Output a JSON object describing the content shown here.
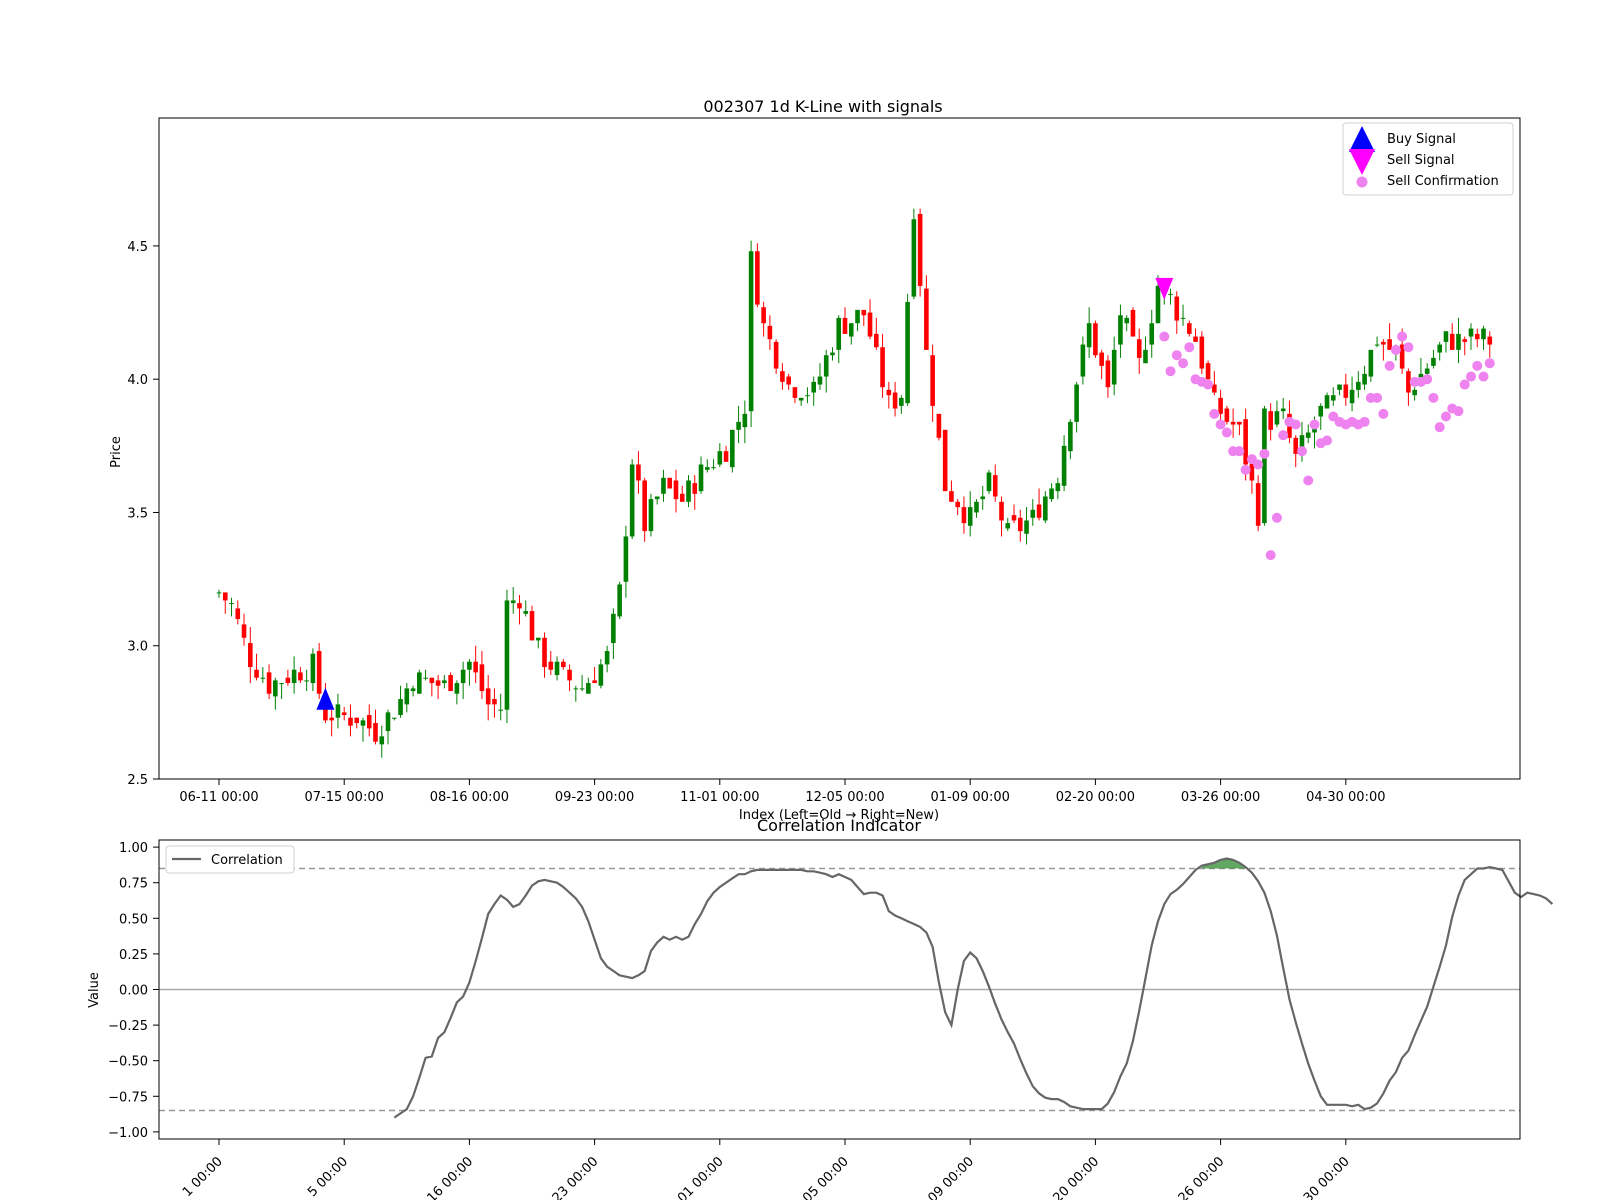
{
  "price_chart": {
    "title": "002307 1d K-Line with signals",
    "ylabel": "Price",
    "xlabel": "Index (Left=Old → Right=New)",
    "ylim": [
      2.5,
      4.98
    ],
    "yticks": [
      "2.5",
      "3.0",
      "3.5",
      "4.0",
      "4.5"
    ],
    "ytick_values": [
      2.5,
      3.0,
      3.5,
      4.0,
      4.5
    ],
    "xticks": [
      "06-11 00:00",
      "07-15 00:00",
      "08-16 00:00",
      "09-23 00:00",
      "11-01 00:00",
      "12-05 00:00",
      "01-09 00:00",
      "02-20 00:00",
      "03-26 00:00",
      "04-30 00:00"
    ],
    "legend": {
      "position": "top-right",
      "items": [
        {
          "label": "Buy Signal",
          "marker": "triangle-up",
          "color": "#0000ff"
        },
        {
          "label": "Sell Signal",
          "marker": "triangle-down",
          "color": "#ff00ff"
        },
        {
          "label": "Sell Confirmation",
          "marker": "circle",
          "color": "#ee82ee"
        }
      ]
    },
    "colors": {
      "up": "#008000",
      "down": "#ff0000"
    }
  },
  "correlation_chart": {
    "title": "Correlation Indicator",
    "ylabel": "Value",
    "ylim": [
      -1.05,
      1.05
    ],
    "yticks": [
      "1.00",
      "0.75",
      "0.50",
      "0.25",
      "0.00",
      "−0.25",
      "−0.50",
      "−0.75",
      "−1.00"
    ],
    "ytick_values": [
      1.0,
      0.75,
      0.5,
      0.25,
      0.0,
      -0.25,
      -0.5,
      -0.75,
      -1.0
    ],
    "xticks": [
      "1 00:00",
      "5 00:00",
      "16 00:00",
      "23 00:00",
      "01 00:00",
      "05 00:00",
      "09 00:00",
      "20 00:00",
      "26 00:00",
      "30 00:00"
    ],
    "legend": {
      "position": "top-left",
      "items": [
        {
          "label": "Correlation",
          "color": "#666666"
        }
      ]
    },
    "thresholds": [
      0.85,
      -0.85
    ],
    "zero_line": 0.0
  },
  "chart_data": {
    "type": "candlestick",
    "x_tick_indices": [
      0,
      20,
      40,
      60,
      80,
      100,
      120,
      140,
      160,
      180
    ],
    "candles": [],
    "buy_signals": [
      {
        "index": 17,
        "price": 2.79
      }
    ],
    "sell_signals": [
      {
        "index": 151,
        "price": 4.35
      }
    ],
    "sell_confirmations": [
      {
        "index": 151,
        "price": 4.16
      },
      {
        "index": 152,
        "price": 4.03
      },
      {
        "index": 153,
        "price": 4.09
      },
      {
        "index": 154,
        "price": 4.06
      },
      {
        "index": 155,
        "price": 4.12
      },
      {
        "index": 156,
        "price": 4.0
      },
      {
        "index": 157,
        "price": 3.99
      },
      {
        "index": 158,
        "price": 3.98
      },
      {
        "index": 159,
        "price": 3.87
      },
      {
        "index": 160,
        "price": 3.83
      },
      {
        "index": 161,
        "price": 3.8
      },
      {
        "index": 162,
        "price": 3.73
      },
      {
        "index": 163,
        "price": 3.73
      },
      {
        "index": 164,
        "price": 3.66
      },
      {
        "index": 165,
        "price": 3.7
      },
      {
        "index": 166,
        "price": 3.68
      },
      {
        "index": 167,
        "price": 3.72
      },
      {
        "index": 168,
        "price": 3.34
      },
      {
        "index": 169,
        "price": 3.48
      },
      {
        "index": 170,
        "price": 3.79
      },
      {
        "index": 171,
        "price": 3.84
      },
      {
        "index": 172,
        "price": 3.83
      },
      {
        "index": 173,
        "price": 3.73
      },
      {
        "index": 174,
        "price": 3.62
      },
      {
        "index": 175,
        "price": 3.83
      },
      {
        "index": 176,
        "price": 3.76
      },
      {
        "index": 177,
        "price": 3.77
      },
      {
        "index": 178,
        "price": 3.86
      },
      {
        "index": 179,
        "price": 3.84
      },
      {
        "index": 180,
        "price": 3.83
      },
      {
        "index": 181,
        "price": 3.84
      },
      {
        "index": 182,
        "price": 3.83
      },
      {
        "index": 183,
        "price": 3.84
      },
      {
        "index": 184,
        "price": 3.93
      },
      {
        "index": 185,
        "price": 3.93
      },
      {
        "index": 186,
        "price": 3.87
      },
      {
        "index": 187,
        "price": 4.05
      },
      {
        "index": 188,
        "price": 4.11
      },
      {
        "index": 189,
        "price": 4.16
      },
      {
        "index": 190,
        "price": 4.12
      },
      {
        "index": 191,
        "price": 3.99
      },
      {
        "index": 192,
        "price": 3.99
      },
      {
        "index": 193,
        "price": 4.0
      },
      {
        "index": 194,
        "price": 3.93
      },
      {
        "index": 195,
        "price": 3.82
      },
      {
        "index": 196,
        "price": 3.86
      },
      {
        "index": 197,
        "price": 3.89
      },
      {
        "index": 198,
        "price": 3.88
      },
      {
        "index": 199,
        "price": 3.98
      },
      {
        "index": 200,
        "price": 4.01
      },
      {
        "index": 201,
        "price": 4.05
      },
      {
        "index": 202,
        "price": 4.01
      },
      {
        "index": 203,
        "price": 4.06
      }
    ],
    "correlation": {
      "name": "Correlation",
      "start_index": 28,
      "values": [
        -0.9,
        -0.87,
        -0.84,
        -0.75,
        -0.62,
        -0.48,
        -0.47,
        -0.34,
        -0.3,
        -0.2,
        -0.09,
        -0.05,
        0.05,
        0.2,
        0.36,
        0.53,
        0.6,
        0.66,
        0.63,
        0.58,
        0.6,
        0.66,
        0.73,
        0.76,
        0.77,
        0.76,
        0.75,
        0.72,
        0.68,
        0.64,
        0.58,
        0.48,
        0.35,
        0.22,
        0.16,
        0.13,
        0.1,
        0.09,
        0.08,
        0.1,
        0.13,
        0.27,
        0.33,
        0.37,
        0.35,
        0.37,
        0.35,
        0.37,
        0.46,
        0.53,
        0.62,
        0.68,
        0.72,
        0.75,
        0.78,
        0.81,
        0.81,
        0.83,
        0.84,
        0.84,
        0.84,
        0.84,
        0.84,
        0.84,
        0.84,
        0.84,
        0.83,
        0.83,
        0.82,
        0.81,
        0.79,
        0.81,
        0.79,
        0.77,
        0.72,
        0.67,
        0.68,
        0.68,
        0.66,
        0.55,
        0.52,
        0.5,
        0.48,
        0.46,
        0.44,
        0.4,
        0.3,
        0.05,
        -0.16,
        -0.25,
        0.0,
        0.2,
        0.26,
        0.22,
        0.13,
        0.02,
        -0.1,
        -0.21,
        -0.3,
        -0.38,
        -0.49,
        -0.59,
        -0.68,
        -0.73,
        -0.76,
        -0.77,
        -0.77,
        -0.79,
        -0.82,
        -0.83,
        -0.84,
        -0.84,
        -0.84,
        -0.84,
        -0.8,
        -0.72,
        -0.61,
        -0.52,
        -0.36,
        -0.15,
        0.08,
        0.31,
        0.48,
        0.6,
        0.67,
        0.7,
        0.74,
        0.79,
        0.84,
        0.87,
        0.88,
        0.89,
        0.91,
        0.92,
        0.91,
        0.89,
        0.86,
        0.82,
        0.76,
        0.68,
        0.55,
        0.38,
        0.15,
        -0.07,
        -0.23,
        -0.38,
        -0.52,
        -0.64,
        -0.75,
        -0.81,
        -0.81,
        -0.81,
        -0.81,
        -0.82,
        -0.81,
        -0.84,
        -0.83,
        -0.8,
        -0.73,
        -0.64,
        -0.58,
        -0.48,
        -0.43,
        -0.32,
        -0.22,
        -0.12,
        0.02,
        0.16,
        0.31,
        0.51,
        0.66,
        0.77,
        0.81,
        0.85,
        0.85,
        0.86,
        0.85,
        0.84,
        0.76,
        0.68,
        0.65,
        0.68,
        0.67,
        0.66,
        0.64,
        0.6
      ]
    }
  }
}
